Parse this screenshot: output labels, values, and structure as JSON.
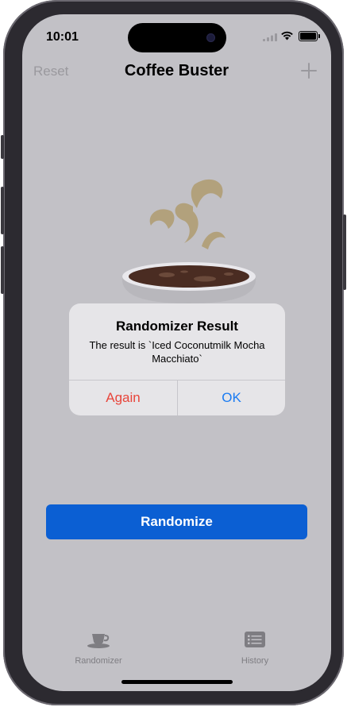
{
  "status_bar": {
    "time": "10:01"
  },
  "nav": {
    "reset_label": "Reset",
    "title": "Coffee Buster",
    "add_icon": "plus-icon"
  },
  "hero_icon": "coffee-cup-illustration",
  "alert": {
    "title": "Randomizer Result",
    "message": "The result is `Iced Coconutmilk Mocha Macchiato`",
    "buttons": {
      "again": "Again",
      "ok": "OK"
    },
    "again_color": "#e8453b",
    "ok_color": "#1a7bf2"
  },
  "main": {
    "randomize_label": "Randomize",
    "accent": "#0b5fd3"
  },
  "tab_bar": {
    "items": [
      {
        "label": "Randomizer",
        "icon": "coffee-cup-icon"
      },
      {
        "label": "History",
        "icon": "list-icon"
      }
    ]
  }
}
